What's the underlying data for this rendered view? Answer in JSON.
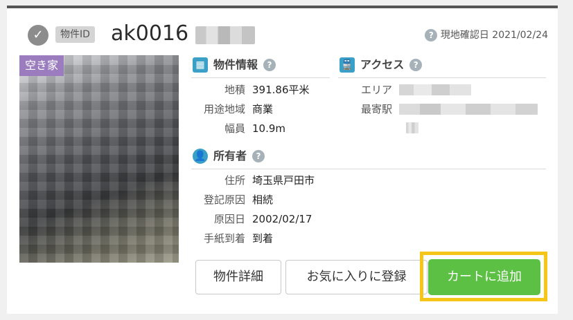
{
  "header": {
    "id_tag": "物件ID",
    "property_id": "ak0016",
    "confirm_label": "現地確認日 2021/02/24",
    "help_glyph": "?"
  },
  "photo": {
    "vacant_badge": "空き家"
  },
  "property_info": {
    "title": "物件情報",
    "rows": [
      {
        "label": "地積",
        "value": "391.86平米"
      },
      {
        "label": "用途地域",
        "value": "商業"
      },
      {
        "label": "幅員",
        "value": "10.9m"
      }
    ]
  },
  "access": {
    "title": "アクセス",
    "rows": [
      {
        "label": "エリア",
        "value": ""
      },
      {
        "label": "最寄駅",
        "value": ""
      }
    ]
  },
  "owner": {
    "title": "所有者",
    "rows": [
      {
        "label": "住所",
        "value": "埼玉県戸田市"
      },
      {
        "label": "登記原因",
        "value": "相続"
      },
      {
        "label": "原因日",
        "value": "2002/02/17"
      },
      {
        "label": "手紙到着",
        "value": "到着"
      }
    ]
  },
  "buttons": {
    "detail": "物件詳細",
    "favorite": "お気に入りに登録",
    "cart": "カートに追加"
  },
  "icons": {
    "check": "check-circle-icon",
    "help": "question-circle-icon",
    "property_info": "table-grid-icon",
    "access": "train-icon",
    "owner": "user-circle-icon"
  },
  "colors": {
    "accent_blue": "#3aa0c8",
    "vacant_badge": "#9a7cbf",
    "cart_green": "#5cc045",
    "highlight_yellow": "#f5c518"
  }
}
